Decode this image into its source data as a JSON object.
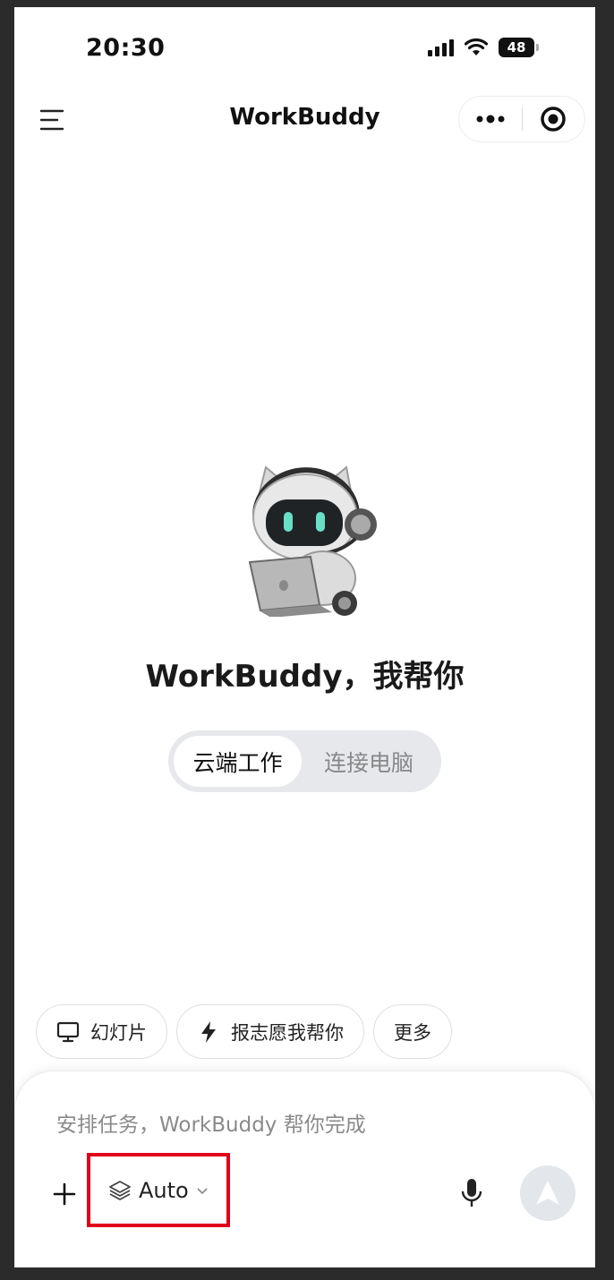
{
  "status_bar": {
    "time": "20:30",
    "battery": "48",
    "battery_level_percent": 48,
    "icons": [
      "cellular-signal-icon",
      "wifi-icon",
      "battery-icon"
    ]
  },
  "header": {
    "title": "WorkBuddy",
    "icons": [
      "menu-icon",
      "more-dots-icon",
      "target-icon"
    ]
  },
  "hero": {
    "mascot": "robot-cat-with-laptop",
    "title": "WorkBuddy，我帮你"
  },
  "mode_toggle": {
    "options": [
      "云端工作",
      "连接电脑"
    ],
    "selected": "云端工作"
  },
  "suggestions": [
    {
      "label": "幻灯片",
      "icon": "monitor-icon"
    },
    {
      "label": "报志愿我帮你",
      "icon": "lightning-icon"
    },
    {
      "label": "更多",
      "icon": ""
    }
  ],
  "composer": {
    "placeholder": "安排任务，WorkBuddy 帮你完成",
    "model_label": "Auto",
    "icons": [
      "plus-icon",
      "layers-icon",
      "chevron-down-icon",
      "microphone-icon",
      "send-arrow-icon"
    ]
  },
  "colors": {
    "highlight_box": "#e0001a",
    "toggle_bg": "#e6e8ec",
    "send_button_bg": "#e3e6ea"
  }
}
